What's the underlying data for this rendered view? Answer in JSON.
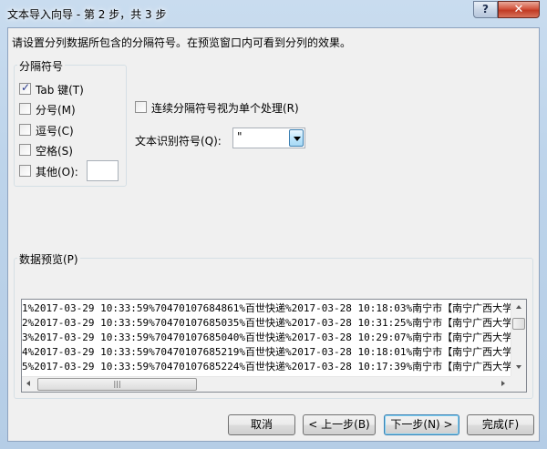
{
  "window": {
    "title": "文本导入向导 - 第 2 步，共 3 步",
    "help_label": "?",
    "close_label": "✕"
  },
  "instruction": "请设置分列数据所包含的分隔符号。在预览窗口内可看到分列的效果。",
  "delimiters": {
    "group_label": "分隔符号",
    "tab": {
      "label": "Tab 键(T)",
      "checked": true
    },
    "semicolon": {
      "label": "分号(M)",
      "checked": false
    },
    "comma": {
      "label": "逗号(C)",
      "checked": false
    },
    "space": {
      "label": "空格(S)",
      "checked": false
    },
    "other": {
      "label": "其他(O):",
      "checked": false,
      "value": ""
    }
  },
  "consecutive": {
    "label": "连续分隔符号视为单个处理(R)",
    "checked": false
  },
  "text_qualifier": {
    "label": "文本识别符号(Q):",
    "value": "\""
  },
  "preview": {
    "group_label": "数据预览(P)",
    "rows": [
      "1%2017-03-29 10:33:59%70470107684861%百世快递%2017-03-28 10:18:03%南宁市【南宁广西大学分部】",
      "2%2017-03-29 10:33:59%70470107685035%百世快递%2017-03-28 10:31:25%南宁市【南宁广西大学分部】",
      "3%2017-03-29 10:33:59%70470107685040%百世快递%2017-03-28 10:29:07%南宁市【南宁广西大学分部】",
      "4%2017-03-29 10:33:59%70470107685219%百世快递%2017-03-28 10:18:01%南宁市【南宁广西大学分部】",
      "5%2017-03-29 10:33:59%70470107685224%百世快递%2017-03-28 10:17:39%南宁市【南宁广西大学分部】"
    ],
    "hscroll_grip": "|||"
  },
  "buttons": {
    "cancel": "取消",
    "back": "< 上一步(B)",
    "next": "下一步(N) >",
    "finish": "完成(F)"
  }
}
